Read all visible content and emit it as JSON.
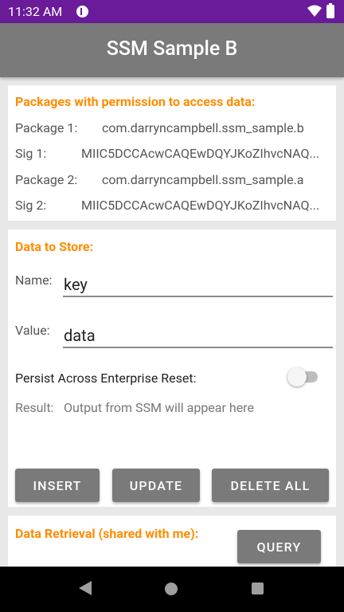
{
  "status_bar": {
    "time": "11:32 AM"
  },
  "app_bar": {
    "title": "SSM Sample B"
  },
  "packages": {
    "title": "Packages with permission to access data:",
    "package1_label": "Package 1:",
    "package1_value": "com.darryncampbell.ssm_sample.b",
    "sig1_label": "Sig 1:",
    "sig1_value": "MIIC5DCCAcwCAQEwDQYJKoZIhvcNAQ...",
    "package2_label": "Package 2:",
    "package2_value": "com.darryncampbell.ssm_sample.a",
    "sig2_label": "Sig 2:",
    "sig2_value": "MIIC5DCCAcwCAQEwDQYJKoZIhvcNAQ..."
  },
  "store": {
    "title": "Data to Store:",
    "name_label": "Name:",
    "name_value": "key",
    "value_label": "Value:",
    "value_value": "data",
    "persist_label": "Persist Across Enterprise Reset:",
    "persist_on": false,
    "result_label": "Result:",
    "result_value": "Output from SSM will appear here",
    "insert_label": "INSERT",
    "update_label": "UPDATE",
    "delete_all_label": "DELETE ALL"
  },
  "retrieval": {
    "title": "Data Retrieval (shared with me):",
    "query_label": "QUERY"
  },
  "colors": {
    "status_bar": "#6a1b9a",
    "app_bar": "#7a7a7a",
    "accent": "#ff8c00",
    "button": "#7a7a7a"
  }
}
